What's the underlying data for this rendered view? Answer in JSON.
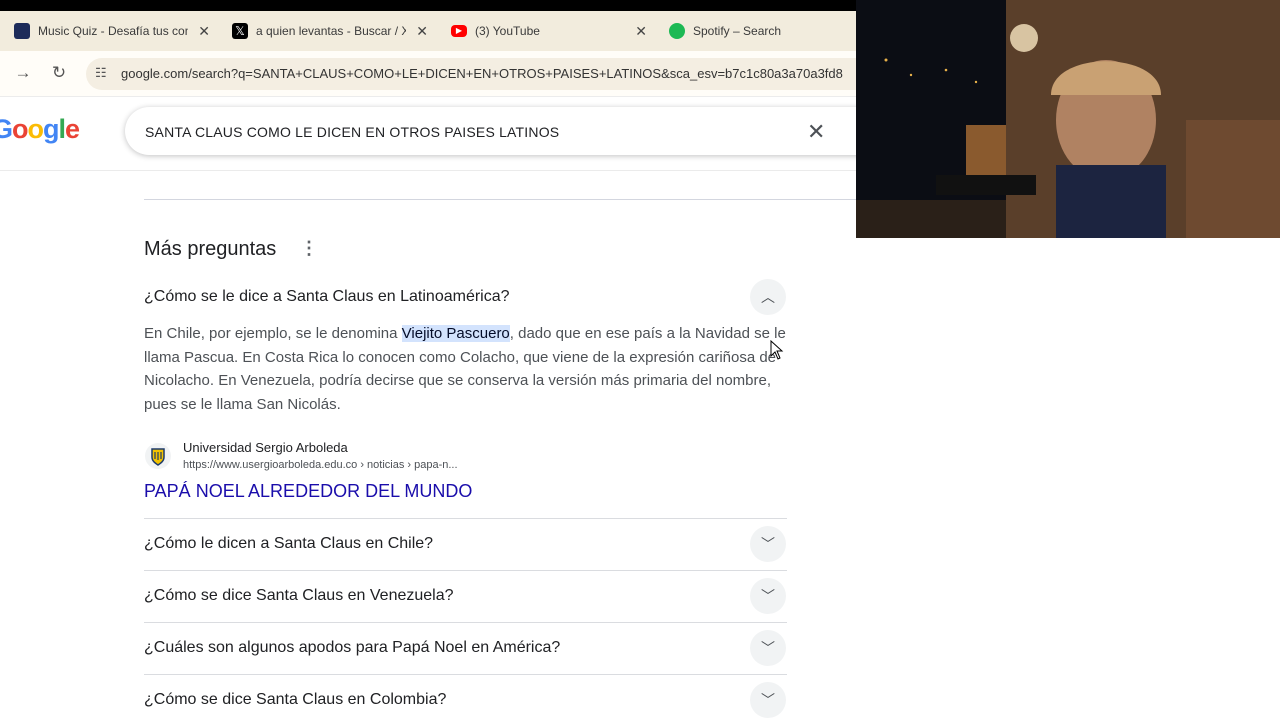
{
  "browser": {
    "tabs": [
      {
        "title": "Music Quiz - Desafía tus con",
        "icon": "music-quiz-icon",
        "color": "#1d2b5a"
      },
      {
        "title": "a quien levantas - Buscar / X",
        "icon": "x-logo-icon",
        "color": "#000000"
      },
      {
        "title": "(3) YouTube",
        "icon": "youtube-icon",
        "color": "#ff0000"
      },
      {
        "title": "Spotify – Search",
        "icon": "spotify-icon",
        "color": "#1db954"
      }
    ],
    "url": "google.com/search?q=SANTA+CLAUS+COMO+LE+DICEN+EN+OTROS+PAISES+LATINOS&sca_esv=b7c1c80a3a70a3fd8"
  },
  "search": {
    "logo": "Google",
    "query": "SANTA CLAUS COMO LE DICEN EN OTROS PAISES LATINOS"
  },
  "paa": {
    "title": "Más preguntas",
    "expanded": {
      "question": "¿Cómo se le dice a Santa Claus en Latinoamérica?",
      "answer_before": "En Chile, por ejemplo, se le denomina ",
      "answer_highlight": "Viejito Pascuero",
      "answer_after": ", dado que en ese país a la Navidad se le llama Pascua. En Costa Rica lo conocen como Colacho, que viene de la expresión cariñosa de Nicolacho. En Venezuela, podría decirse que se conserva la versión más primaria del nombre, pues se le llama San Nicolás.",
      "source_name": "Universidad Sergio Arboleda",
      "source_url": "https://www.usergioarboleda.edu.co › noticias › papa-n...",
      "source_title": "PAPÁ NOEL ALREDEDOR DEL MUNDO"
    },
    "questions": [
      "¿Cómo le dicen a Santa Claus en Chile?",
      "¿Cómo se dice Santa Claus en Venezuela?",
      "¿Cuáles son algunos apodos para Papá Noel en América?",
      "¿Cómo se dice Santa Claus en Colombia?"
    ]
  }
}
